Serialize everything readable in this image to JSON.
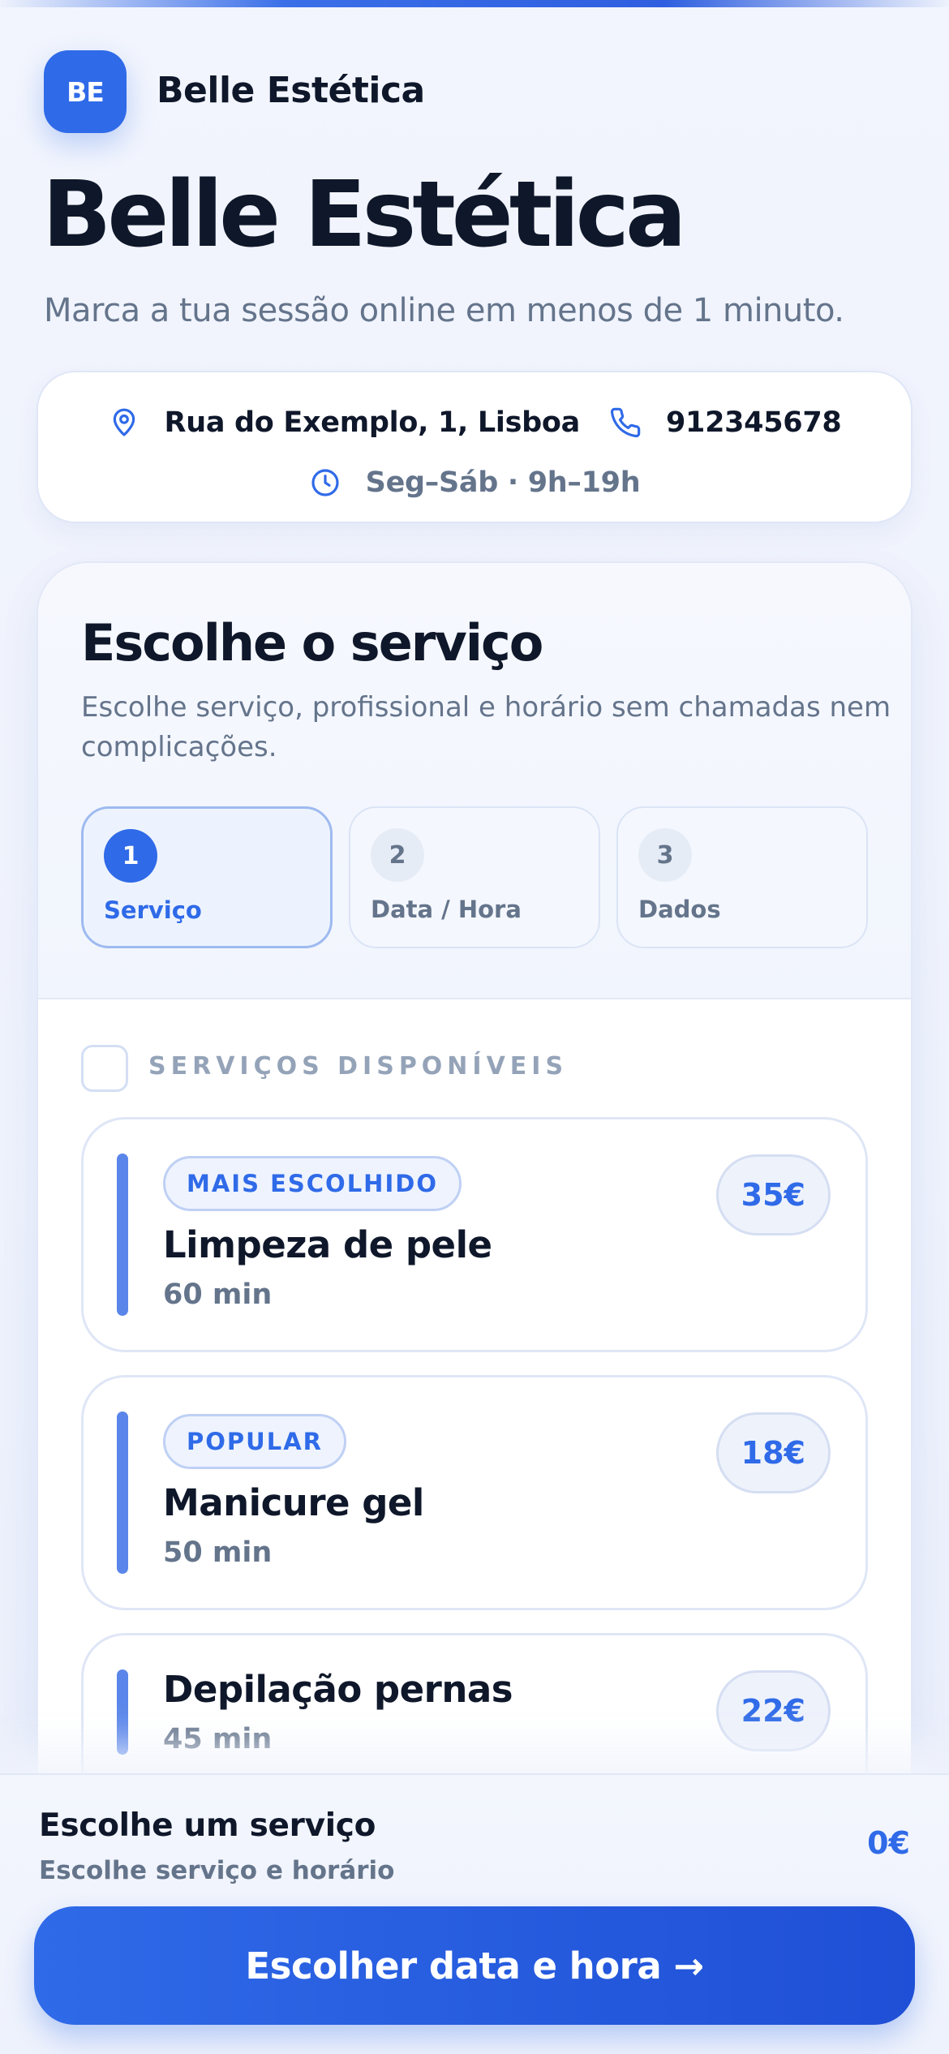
{
  "header": {
    "logo_initials": "BE",
    "brand_name": "Belle Estética",
    "hero_title": "Belle Estética",
    "hero_subtitle": "Marca a tua sessão online em menos de 1 minuto."
  },
  "info": {
    "address": "Rua do Exemplo, 1, Lisboa",
    "phone": "912345678",
    "hours": "Seg–Sáb · 9h–19h",
    "icons": [
      "location-pin-icon",
      "phone-icon",
      "clock-icon"
    ]
  },
  "booking": {
    "title": "Escolhe o serviço",
    "subtitle": "Escolhe serviço, profissional e horário sem chamadas nem complicações.",
    "steps": [
      {
        "num": "1",
        "label": "Serviço",
        "active": true
      },
      {
        "num": "2",
        "label": "Data / Hora",
        "active": false
      },
      {
        "num": "3",
        "label": "Dados",
        "active": false
      }
    ],
    "section_label": "SERVIÇOS DISPONÍVEIS",
    "services": [
      {
        "badge": "MAIS ESCOLHIDO",
        "name": "Limpeza de pele",
        "duration": "60 min",
        "price": "35€"
      },
      {
        "badge": "POPULAR",
        "name": "Manicure gel",
        "duration": "50 min",
        "price": "18€"
      },
      {
        "badge": "",
        "name": "Depilação pernas",
        "duration": "45 min",
        "price": "22€"
      }
    ]
  },
  "bottom": {
    "title": "Escolhe um serviço",
    "subtitle": "Escolhe serviço e horário",
    "total": "0€",
    "cta_label": "Escolher data e hora →"
  },
  "colors": {
    "accent": "#2f6ae8",
    "text": "#0f172a",
    "muted": "#64748b",
    "background": "#f2f5fd"
  }
}
